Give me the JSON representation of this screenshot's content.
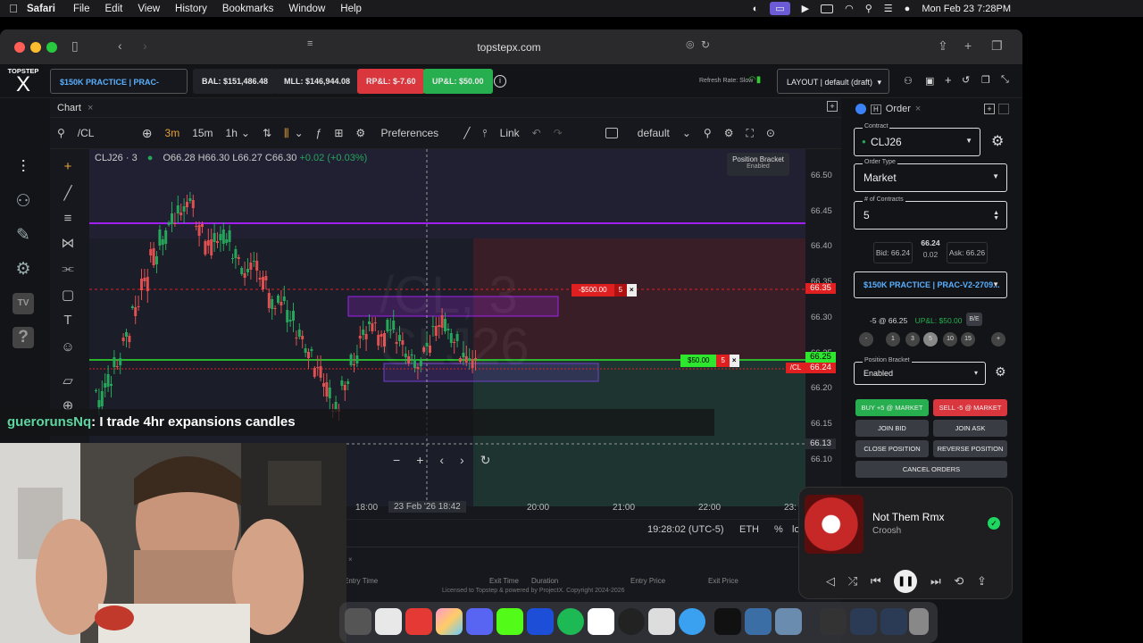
{
  "menubar": {
    "app": "Safari",
    "items": [
      "File",
      "Edit",
      "View",
      "History",
      "Bookmarks",
      "Window",
      "Help"
    ],
    "datetime": "Mon Feb 23  7:28PM"
  },
  "browser": {
    "url": "topstepx.com"
  },
  "topbar": {
    "logo_top": "TOPSTEP",
    "logo_bottom": "X",
    "account": "$150K PRACTICE | PRAC-V2-...",
    "balance": "BAL: $151,486.48",
    "mll": "MLL: $146,944.08",
    "rpl": "RP&L: $-7.60",
    "upl": "UP&L: $50.00",
    "refresh": "Refresh Rate: Slow",
    "layout": "LAYOUT | default (draft)"
  },
  "chart": {
    "tab": "Chart",
    "symbol": "/CL",
    "intervals": [
      "3m",
      "15m",
      "1h"
    ],
    "preferences": "Preferences",
    "link": "Link",
    "template": "default",
    "legend_symbol": "CLJ26 · 3",
    "ohlc": {
      "o": "O66.28",
      "h": "H66.30",
      "l": "L66.27",
      "c": "C66.30",
      "chg": "+0.02 (+0.03%)"
    },
    "bracket_label": "Position Bracket",
    "bracket_sub": "Enabled",
    "watermark_1": "/CL, 3",
    "watermark_2": "CLJ26",
    "price_ticks": [
      "66.50",
      "66.45",
      "66.40",
      "66.35",
      "66.30",
      "66.25",
      "66.20",
      "66.15",
      "66.10"
    ],
    "price_tags": {
      "stop": "66.35",
      "last": "66.25",
      "cl": "/CL",
      "cl_price": "66.24",
      "cursor": "66.13"
    },
    "order_tags": {
      "stop": "-$500.00",
      "stop_qty": "5",
      "target": "$50.00",
      "target_qty": "5"
    },
    "time_ticks": [
      "18:00",
      "20:00",
      "21:00",
      "22:00",
      "23:"
    ],
    "cursor_time": "23 Feb '26   18:42",
    "clock": "19:28:02 (UTC-5)",
    "session": "ETH",
    "pct": "%",
    "log": "lo",
    "table_cols": [
      "Entry Time",
      "Exit Time",
      "Duration",
      "Entry Price",
      "Exit Price"
    ],
    "footer": "Licensed to Topstep & powered by ProjectX. Copyright 2024-2026"
  },
  "order": {
    "tab": "Order",
    "contract_label": "Contract",
    "contract": "CLJ26",
    "type_label": "Order Type",
    "type": "Market",
    "qty_label": "# of Contracts",
    "qty": "5",
    "bid": "Bid: 66.24",
    "last": "66.24",
    "spread": "0.02",
    "ask": "Ask: 66.26",
    "account": "$150K PRACTICE | PRAC-V2-2709...",
    "position": "-5 @ 66.25",
    "upl": "UP&L: $50.00",
    "be": "B/E",
    "quick": [
      "-",
      "1",
      "3",
      "5",
      "10",
      "15",
      "+"
    ],
    "bracket_label": "Position Bracket",
    "bracket": "Enabled",
    "buy": "BUY +5 @ MARKET",
    "sell": "SELL -5 @ MARKET",
    "join_bid": "JOIN BID",
    "join_ask": "JOIN ASK",
    "close": "CLOSE POSITION",
    "reverse": "REVERSE POSITION",
    "cancel": "CANCEL ORDERS"
  },
  "chat": {
    "user": "guerorunsNq",
    "message": ": I trade 4hr expansions candles"
  },
  "music": {
    "title": "Not Them Rmx",
    "artist": "Croosh"
  },
  "colors": {
    "green": "#22c55e",
    "red": "#e53935",
    "accent": "#3b82f6",
    "purple": "#a020f0"
  }
}
